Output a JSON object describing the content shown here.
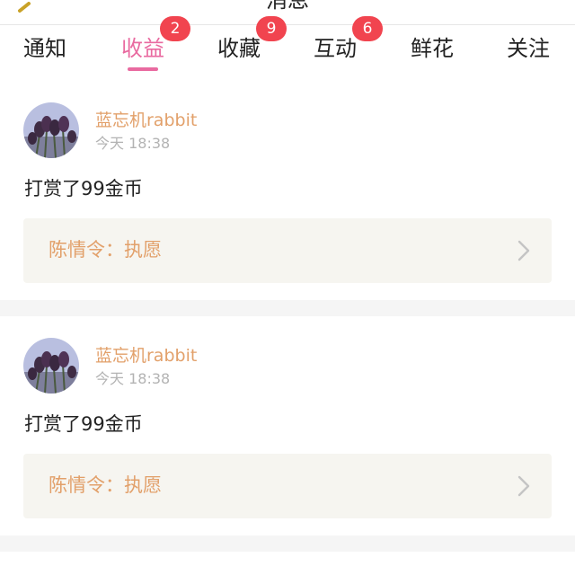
{
  "header": {
    "title": "消息"
  },
  "tabs": [
    {
      "label": "通知",
      "badge": ""
    },
    {
      "label": "收益",
      "badge": "2",
      "active": true
    },
    {
      "label": "收藏",
      "badge": "9"
    },
    {
      "label": "互动",
      "badge": "6"
    },
    {
      "label": "鲜花",
      "badge": ""
    },
    {
      "label": "关注",
      "badge": ""
    }
  ],
  "messages": [
    {
      "user": "蓝忘机rabbit",
      "time": "今天 18:38",
      "text": "打赏了99金币",
      "work": "陈情令：执愿"
    },
    {
      "user": "蓝忘机rabbit",
      "time": "今天 18:38",
      "text": "打赏了99金币",
      "work": "陈情令：执愿"
    }
  ],
  "colors": {
    "accent": "#e96aa0",
    "badge": "#f1444f",
    "username": "#e2a06a",
    "quote_bg": "#f6f5f0"
  }
}
